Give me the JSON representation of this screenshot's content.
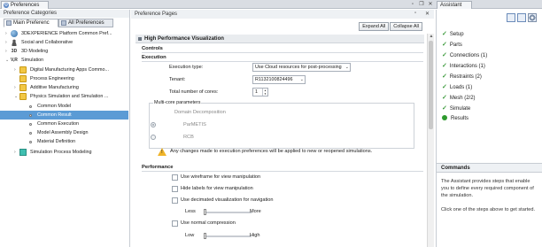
{
  "window": {
    "preferences_tab": "Preferences",
    "assistant_tab": "Assistant"
  },
  "left": {
    "title": "Preference Categories",
    "tabs": [
      "Main Preferenc",
      "All Preferences"
    ],
    "tree": [
      {
        "label": "3DEXPERIENCE Platform Common Pref...",
        "icon": "globe-icon",
        "arrow": "›"
      },
      {
        "label": "Social and Collaborative",
        "icon": "people-icon",
        "arrow": "›"
      },
      {
        "label": "3D Modeling",
        "icon": "3d-icon",
        "arrow": "›",
        "icon_text": "3D"
      },
      {
        "label": "Simulation",
        "icon": "vr-icon",
        "arrow": "⌄",
        "icon_text": "V,R"
      },
      {
        "label": "Digital Manufacturing Apps Commo...",
        "icon": "folder-icon",
        "arrow": "›"
      },
      {
        "label": "Process Engineering",
        "icon": "folder-icon",
        "arrow": ""
      },
      {
        "label": "Additive Manufacturing",
        "icon": "folder-icon",
        "arrow": "›"
      },
      {
        "label": "Physics Simulation and Simulation ...",
        "icon": "folder-icon",
        "arrow": "⌄"
      },
      {
        "label": "Common Model",
        "icon": "dot-icon",
        "arrow": ""
      },
      {
        "label": "Common Result",
        "icon": "dot-icon",
        "arrow": "",
        "selected": true
      },
      {
        "label": "Common Execution",
        "icon": "dot-icon",
        "arrow": ""
      },
      {
        "label": "Model Assembly Design",
        "icon": "dot-icon",
        "arrow": ""
      },
      {
        "label": "Material Definition",
        "icon": "dot-icon",
        "arrow": ""
      },
      {
        "label": "Simulation Process Modeling",
        "icon": "teal-icon",
        "arrow": "›"
      }
    ]
  },
  "mid": {
    "title": "Preference Pages",
    "expand_all": "Expand All",
    "collapse_all": "Collapse All",
    "section_title": "High Performance Visualization",
    "controls_label": "Controls",
    "execution_label": "Execution",
    "execution_type_label": "Execution type:",
    "execution_type_value": "Use Cloud resources for post-processing",
    "tenant_label": "Tenant:",
    "tenant_value": "R1132100824496",
    "cores_label": "Total number of cores:",
    "cores_value": "1",
    "multicore_label": "Multi-core parameters",
    "domain_label": "Domain Decomposition",
    "radio_1": "ParMETIS",
    "radio_2": "RCB",
    "warning_text": "Any changes made to  execution preferences will be applied to new or reopened simulations.",
    "performance_label": "Performance",
    "checks": [
      "Use wireframe for view manipulation",
      "Hide labels for view manipulation",
      "Use decimated visualization for navigation",
      "Use normal compression"
    ],
    "slider1_min": "Less",
    "slider1_max": "More",
    "slider2_min": "Low",
    "slider2_max": "High"
  },
  "right": {
    "steps": [
      {
        "label": "Setup",
        "done": true
      },
      {
        "label": "Parts",
        "done": true
      },
      {
        "label": "Connections (1)",
        "done": true
      },
      {
        "label": "Interactions (1)",
        "done": true
      },
      {
        "label": "Restraints (2)",
        "done": true
      },
      {
        "label": "Loads (1)",
        "done": true
      },
      {
        "label": "Mesh (2/2)",
        "done": true
      },
      {
        "label": "Simulate",
        "done": true
      },
      {
        "label": "Results",
        "done": false
      }
    ],
    "commands_title": "Commands",
    "commands_text_1": "The Assistant provides steps that enable you to define every required component of the simulation.",
    "commands_text_2": "Click one of the steps above to get started."
  },
  "colors": {
    "selection": "#5b9bd5",
    "check_green": "#3d9b3d",
    "warning": "#f0b429"
  }
}
